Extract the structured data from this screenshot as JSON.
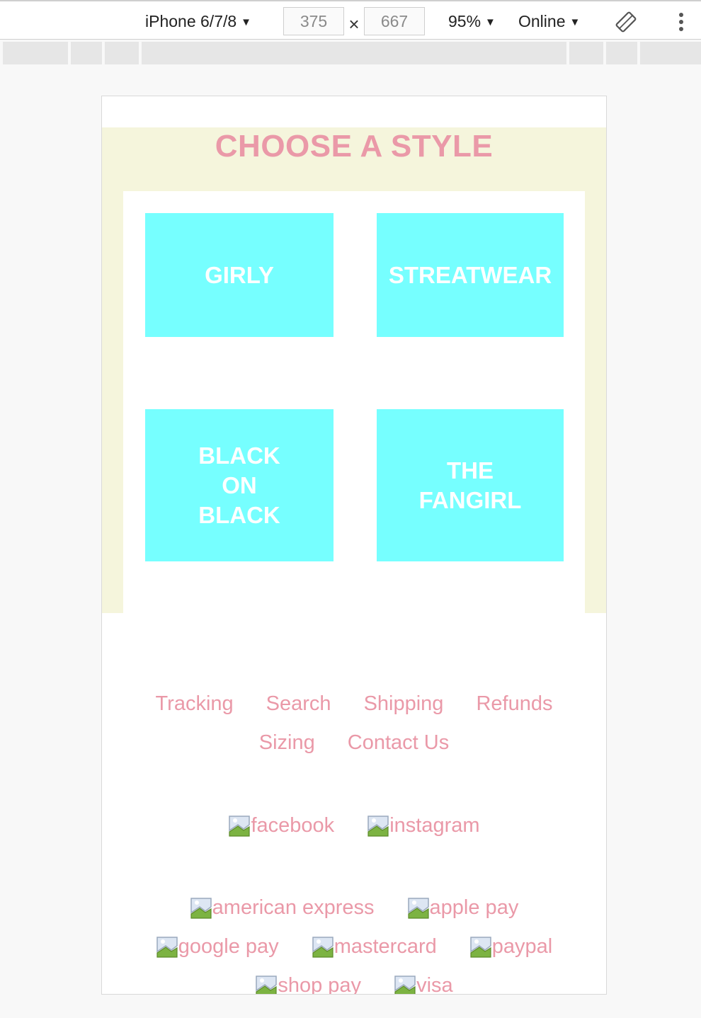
{
  "devtools": {
    "device": "iPhone 6/7/8",
    "width": "375",
    "height": "667",
    "times": "×",
    "zoom": "95%",
    "throttle": "Online",
    "caret": "▼"
  },
  "page": {
    "title": "CHOOSE A STYLE",
    "styles": [
      {
        "label": "GIRLY"
      },
      {
        "label": "STREATWEAR"
      },
      {
        "label": "BLACK ON BLACK"
      },
      {
        "label": "THE FANGIRL"
      }
    ],
    "colors": {
      "accent_pink": "#ea99a8",
      "card_cyan": "#76ffff",
      "section_beige": "#f5f5dc"
    }
  },
  "footer": {
    "links": [
      "Tracking",
      "Search",
      "Shipping",
      "Refunds",
      "Sizing",
      "Contact Us"
    ],
    "social": [
      "facebook",
      "instagram"
    ],
    "payments": [
      "american express",
      "apple pay",
      "google pay",
      "mastercard",
      "paypal",
      "shop pay",
      "visa"
    ]
  }
}
